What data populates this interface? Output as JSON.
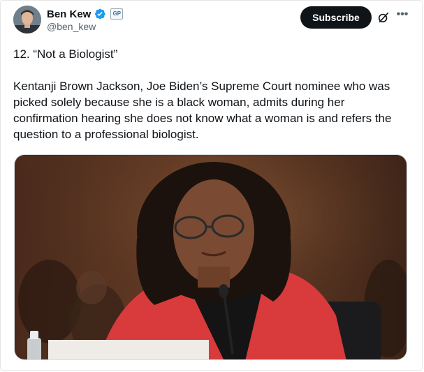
{
  "author": {
    "display_name": "Ben Kew",
    "handle": "@ben_kew",
    "verified_icon": "verified-badge-icon",
    "affiliate_badge": "GP"
  },
  "header": {
    "subscribe_label": "Subscribe",
    "grok_icon": "grok-icon",
    "more_icon": "more-icon"
  },
  "post": {
    "heading": "12. “Not a Biologist”",
    "body": "Kentanji Brown Jackson, Joe Biden’s Supreme Court nominee who was picked solely because she is a black woman, admits during her confirmation hearing she does not know what a woman is and refers the question to a professional biologist."
  },
  "colors": {
    "text": "#0f1419",
    "secondary": "#536471",
    "verified": "#1d9bf0",
    "button_bg": "#0f1419"
  }
}
